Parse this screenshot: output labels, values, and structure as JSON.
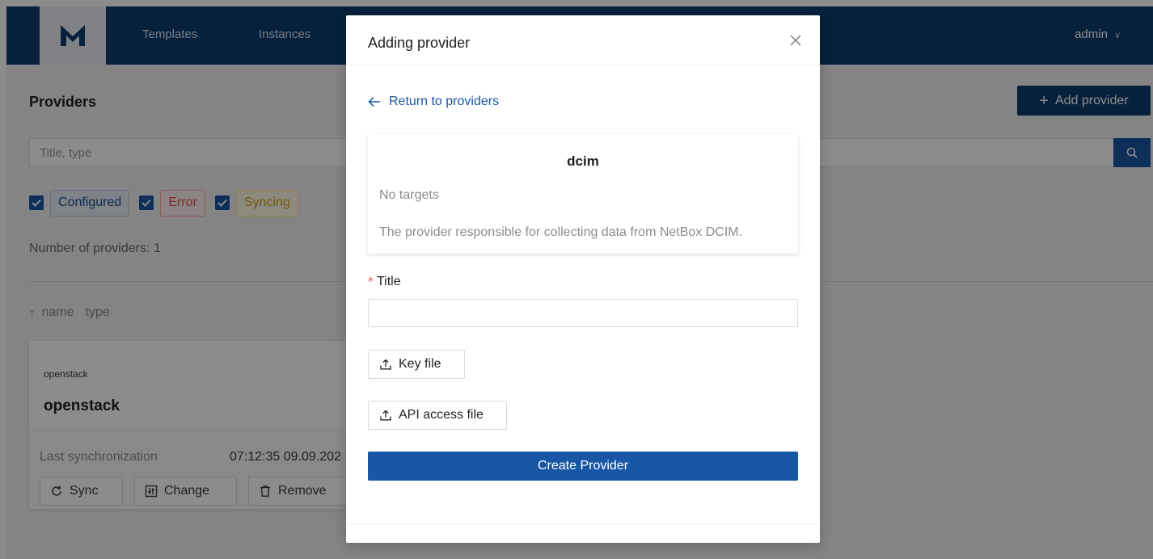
{
  "nav": {
    "templates": "Templates",
    "instances": "Instances",
    "user": "admin"
  },
  "page": {
    "title": "Providers",
    "add_button": "Add provider",
    "search_placeholder": "Title, type",
    "filters": [
      "Configured",
      "Error",
      "Syncing"
    ],
    "count_text": "Number of providers: 1",
    "sort": {
      "name": "name",
      "type": "type"
    }
  },
  "provider_card": {
    "type": "openstack",
    "name": "openstack",
    "last_sync_label": "Last synchronization",
    "last_sync_value": "07:12:35 09.09.202",
    "sync_button": "Sync",
    "change_button": "Change",
    "remove_button": "Remove"
  },
  "modal": {
    "title": "Adding provider",
    "return_link": "Return to providers",
    "provider": {
      "name": "dcim",
      "targets": "No targets",
      "description": "The provider responsible for collecting data from NetBox DCIM."
    },
    "title_label": "Title",
    "title_value": "",
    "key_file_button": "Key file",
    "api_file_button": "API access file",
    "create_button": "Create Provider"
  },
  "colors": {
    "header": "#0d3b6e",
    "primary": "#1857a5",
    "error": "#e05548",
    "syncing": "#d4a41c"
  }
}
